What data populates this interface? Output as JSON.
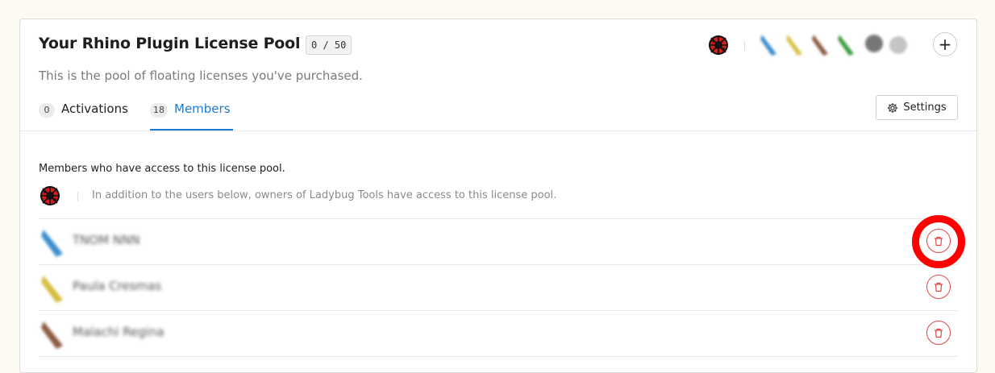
{
  "pool": {
    "title": "Your Rhino Plugin License Pool",
    "usage": "0 / 50",
    "subtitle": "This is the pool of floating licenses you've purchased."
  },
  "header": {
    "org_logo_icon": "ladybug-logo-icon",
    "member_avatar_colors": [
      "#3d8ecf",
      "#d9c24b",
      "#8b5a44",
      "#3f9b3f",
      "#777777",
      "#bbbbbb"
    ],
    "add_button_label": "+"
  },
  "tabs": [
    {
      "count": "0",
      "label": "Activations",
      "active": false
    },
    {
      "count": "18",
      "label": "Members",
      "active": true
    }
  ],
  "settings": {
    "label": "Settings",
    "icon": "gear-icon"
  },
  "members_section": {
    "caption": "Members who have access to this license pool.",
    "owner_note": "In addition to the users below, owners of Ladybug Tools have access to this license pool."
  },
  "members": [
    {
      "name": "TNOM NNN",
      "avatar_color": "#3d8ecf",
      "delete_icon": "trash-icon"
    },
    {
      "name": "Paula Cresmas",
      "avatar_color": "#d4bd3f",
      "delete_icon": "trash-icon"
    },
    {
      "name": "Malachi Regina",
      "avatar_color": "#8b5a44",
      "delete_icon": "trash-icon"
    }
  ],
  "colors": {
    "accent": "#1f7ad1",
    "danger": "#e04848",
    "highlight": "#ff0000"
  }
}
